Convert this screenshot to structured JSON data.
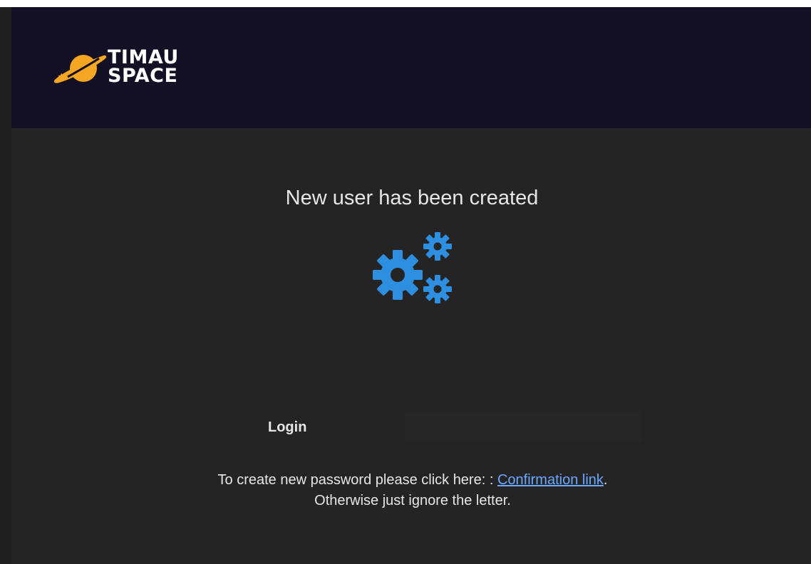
{
  "brand": {
    "line1": "TIMAU",
    "line2": "SPACE",
    "accent": "#f5a623",
    "header_bg": "#130f24"
  },
  "main": {
    "title": "New user has been created",
    "icon": "gears-icon",
    "icon_color": "#2e8ee0",
    "login_label": "Login",
    "login_value": "",
    "note_prefix": "To create new password please click here: : ",
    "link_text": "Confirmation link",
    "note_suffix": ".",
    "note_line2": "Otherwise just ignore the letter."
  }
}
